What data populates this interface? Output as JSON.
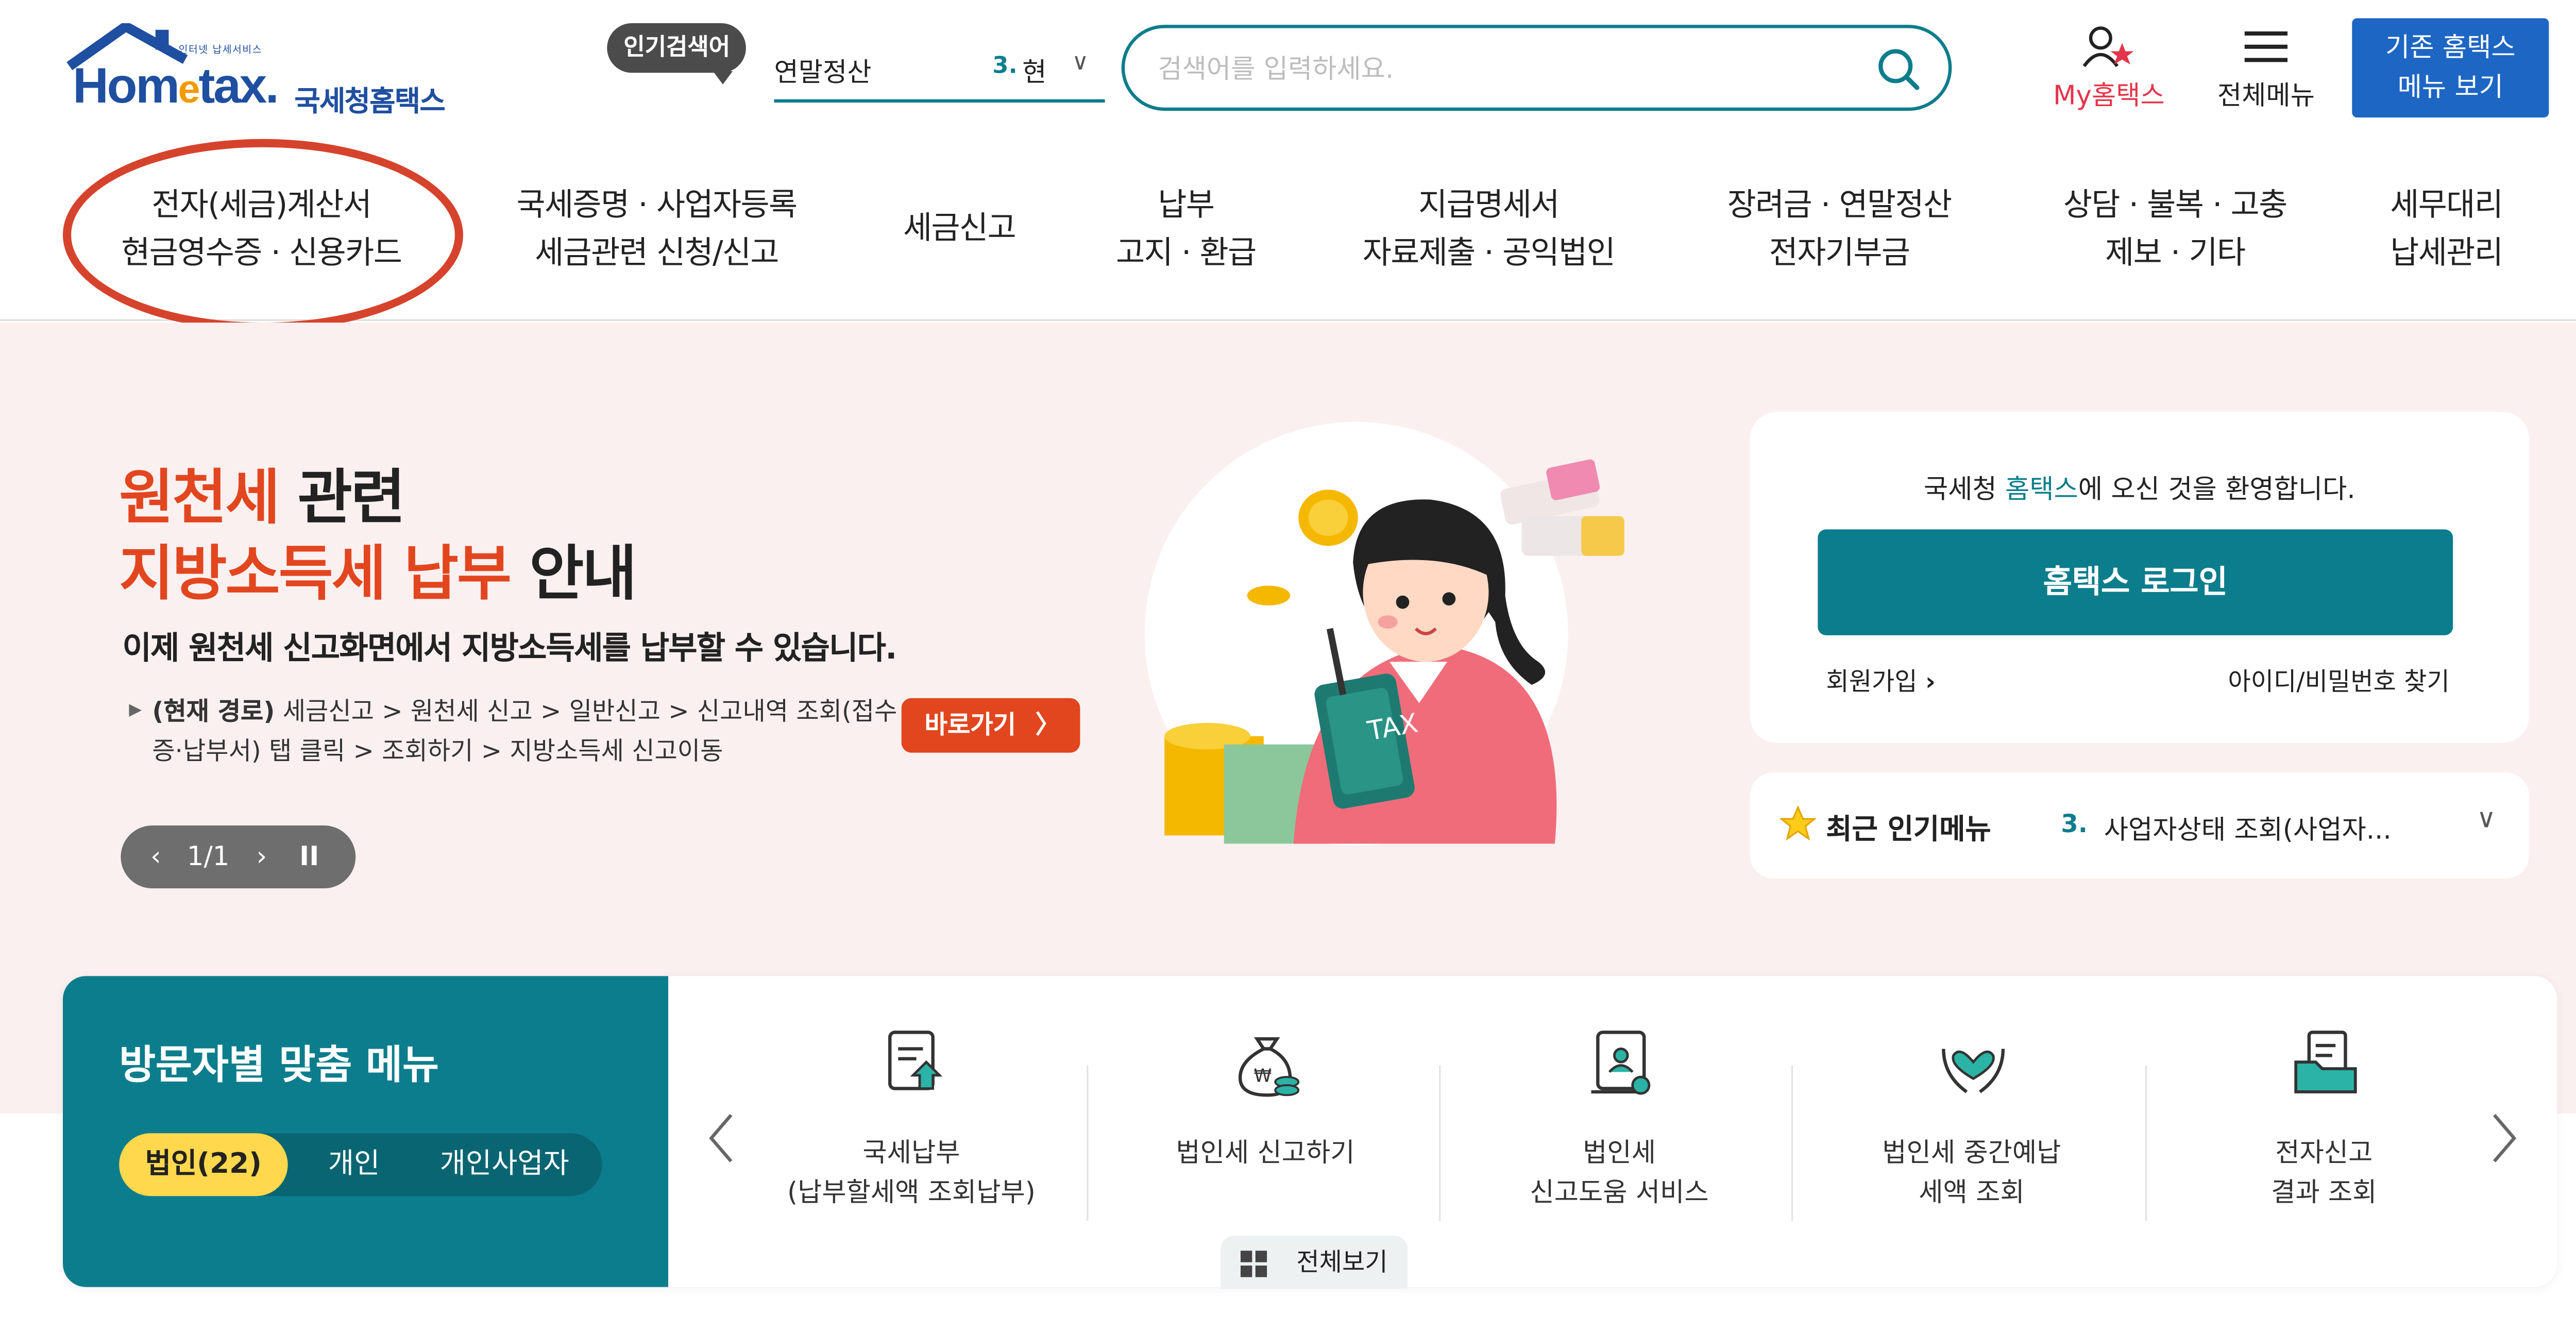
{
  "header": {
    "logo_sub": "인터넷 납세서비스",
    "logo_en_a": "Hom",
    "logo_en_e": "e",
    "logo_en_b": "tax.",
    "logo_kr": "국세청홈택스",
    "popular_badge": "인기검색어",
    "popular_keyword": "연말정산",
    "popular_rank": "3.",
    "popular_rank_text": "현",
    "search_placeholder": "검색어를 입력하세요.",
    "my_hometax": "My홈택스",
    "all_menu": "전체메뉴",
    "old_menu_line1": "기존 홈택스",
    "old_menu_line2": "메뉴 보기"
  },
  "gnb": [
    {
      "line1": "전자(세금)계산서",
      "line2": "현금영수증 · 신용카드"
    },
    {
      "line1": "국세증명 · 사업자등록",
      "line2": "세금관련 신청/신고"
    },
    {
      "line1": "세금신고",
      "line2": ""
    },
    {
      "line1": "납부",
      "line2": "고지 · 환급"
    },
    {
      "line1": "지급명세서",
      "line2": "자료제출 · 공익법인"
    },
    {
      "line1": "장려금 · 연말정산",
      "line2": "전자기부금"
    },
    {
      "line1": "상담 · 불복 · 고충",
      "line2": "제보 · 기타"
    },
    {
      "line1": "세무대리",
      "line2": "납세관리"
    }
  ],
  "hero": {
    "title1_red": "원천세",
    "title1_black": " 관련",
    "title2_red": "지방소득세 납부",
    "title2_black": " 안내",
    "desc": "이제 원천세 신고화면에서 지방소득세를 납부할 수 있습니다.",
    "path_bold": "(현재 경로)",
    "path_text": " 세금신고 > 원천세 신고 > 일반신고 > 신고내역 조회(접수증·납부서) 탭 클릭 > 조회하기 > 지방소득세 신고이동",
    "goto_label": "바로가기",
    "pager_text": "1/1",
    "illus_text": "TAX"
  },
  "login": {
    "welcome_pre": "국세청 ",
    "welcome_hl": "홈택스",
    "welcome_post": "에 오신 것을 환영합니다.",
    "login_button": "홈택스 로그인",
    "join": "회원가입",
    "find": "아이디/비밀번호 찾기"
  },
  "recent": {
    "title": "최근 인기메뉴",
    "rank": "3.",
    "text": "사업자상태 조회(사업자..."
  },
  "visitor": {
    "title": "방문자별 맞춤 메뉴",
    "tabs": [
      "법인(22)",
      "개인",
      "개인사업자"
    ],
    "items": [
      "국세납부\n(납부할세액 조회납부)",
      "법인세 신고하기",
      "법인세\n신고도움 서비스",
      "법인세 중간예납\n세액 조회",
      "전자신고\n결과 조회"
    ],
    "view_all": "전체보기"
  },
  "colors": {
    "teal": "#0c7d8c",
    "red": "#e2461f",
    "hero_bg": "#fbf0f0",
    "yellow_tab": "#ffd84d",
    "highlight_circle": "#d6432c"
  }
}
